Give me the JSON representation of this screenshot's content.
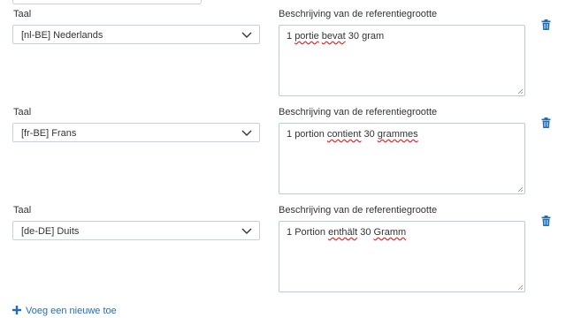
{
  "rows": [
    {
      "language_label": "Taal",
      "description_label": "Beschrijving van de referentiegrootte",
      "selected_language": "[nl-BE] Nederlands",
      "description_words": [
        "1",
        "portie",
        "bevat",
        "30",
        "gram"
      ],
      "misspelled": [
        false,
        true,
        true,
        false,
        false
      ]
    },
    {
      "language_label": "Taal",
      "description_label": "Beschrijving van de referentiegrootte",
      "selected_language": "[fr-BE] Frans",
      "description_words": [
        "1",
        "portion",
        "contient",
        "30",
        "grammes"
      ],
      "misspelled": [
        false,
        false,
        true,
        false,
        true
      ]
    },
    {
      "language_label": "Taal",
      "description_label": "Beschrijving van de referentiegrootte",
      "selected_language": "[de-DE] Duits",
      "description_words": [
        "1",
        "Portion",
        "enthält",
        "30",
        "Gramm"
      ],
      "misspelled": [
        false,
        false,
        true,
        false,
        true
      ]
    }
  ],
  "add_link_label": "Voeg een nieuwe toe",
  "icons": {
    "delete": "trash-icon",
    "dropdown": "chevron-down-icon",
    "add": "plus-icon"
  },
  "colors": {
    "link": "#1f6fb5",
    "delete_icon": "#1f6fb5",
    "border": "#c9d1d8",
    "spellcheck": "#e02020"
  }
}
